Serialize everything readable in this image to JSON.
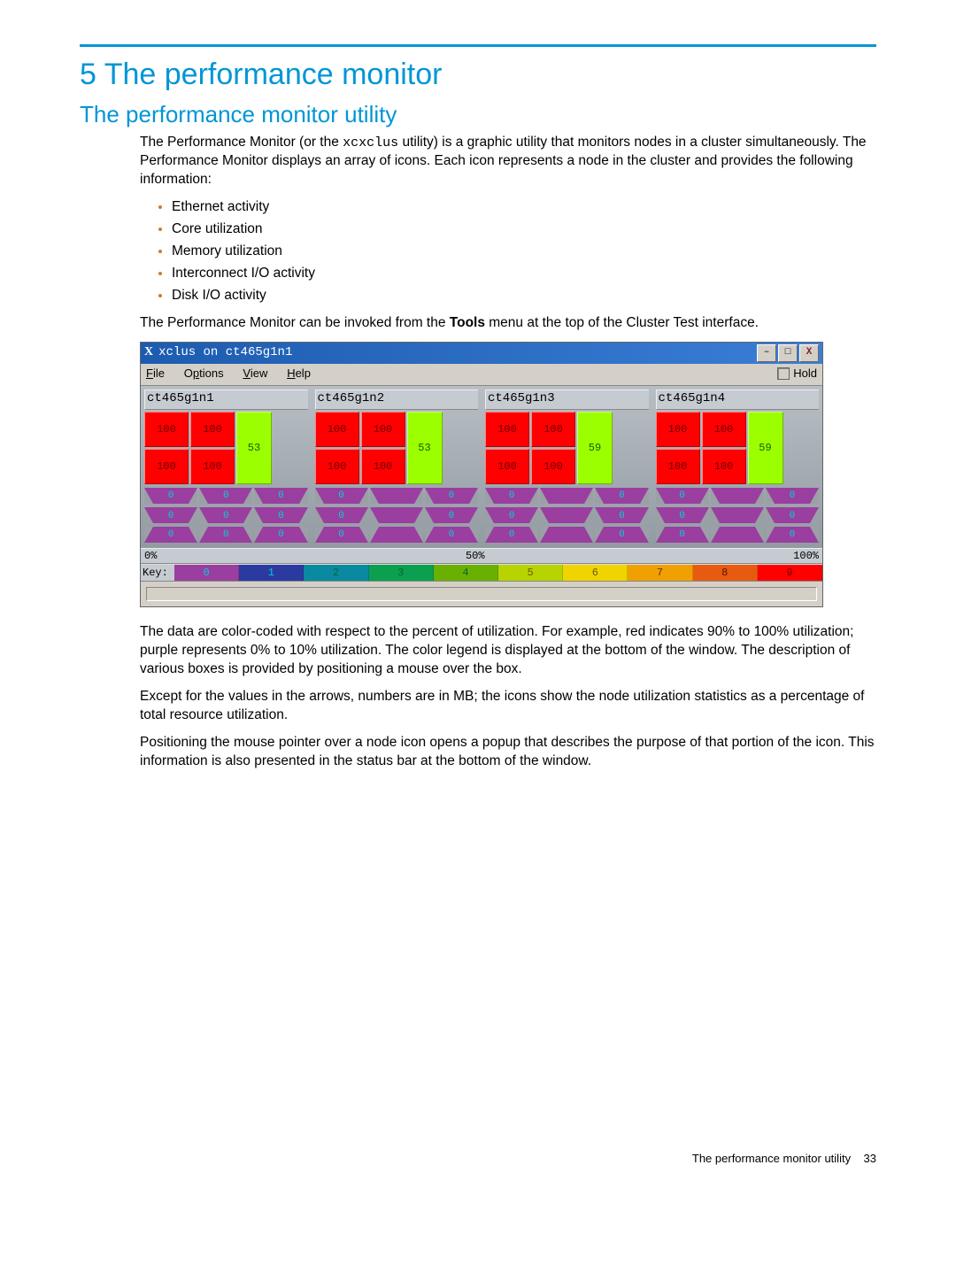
{
  "chapter_title": "5 The performance monitor",
  "section_title": "The performance monitor utility",
  "intro_prefix": "The Performance Monitor (or the ",
  "intro_code": "xcxclus",
  "intro_suffix": " utility) is a graphic utility that monitors nodes in a cluster simultaneously. The Performance Monitor displays an array of icons. Each icon represents a node in the cluster and provides the following information:",
  "bullets": [
    "Ethernet activity",
    "Core utilization",
    "Memory utilization",
    "Interconnect I/O activity",
    "Disk I/O activity"
  ],
  "invoke_prefix": "The Performance Monitor can be invoked from the ",
  "invoke_bold": "Tools",
  "invoke_suffix": " menu at the top of the Cluster Test interface.",
  "window": {
    "title": "xclus on ct465g1n1",
    "menu": {
      "file": "File",
      "options": "Options",
      "view": "View",
      "help": "Help",
      "hold": "Hold"
    },
    "scale": {
      "left": "0%",
      "mid": "50%",
      "right": "100%"
    },
    "key_label": "Key:",
    "key_values": [
      "0",
      "1",
      "2",
      "3",
      "4",
      "5",
      "6",
      "7",
      "8",
      "9"
    ],
    "nodes": [
      {
        "name": "ct465g1n1",
        "cores": [
          "100",
          "100",
          "100",
          "100"
        ],
        "side": "53",
        "arrows_top": [
          "0",
          "0",
          "0"
        ],
        "arrows_mid": [
          "0",
          "0",
          "0"
        ],
        "arrows_bot": [
          "0",
          "0",
          "0"
        ]
      },
      {
        "name": "ct465g1n2",
        "cores": [
          "100",
          "100",
          "100",
          "100"
        ],
        "side": "53",
        "arrows_top": [
          "0",
          "",
          "0"
        ],
        "arrows_mid": [
          "0",
          "",
          "0"
        ],
        "arrows_bot": [
          "0",
          "",
          "0"
        ]
      },
      {
        "name": "ct465g1n3",
        "cores": [
          "100",
          "100",
          "100",
          "100"
        ],
        "side": "59",
        "arrows_top": [
          "0",
          "",
          "0"
        ],
        "arrows_mid": [
          "0",
          "",
          "0"
        ],
        "arrows_bot": [
          "0",
          "",
          "0"
        ]
      },
      {
        "name": "ct465g1n4",
        "cores": [
          "100",
          "100",
          "100",
          "100"
        ],
        "side": "59",
        "arrows_top": [
          "0",
          "",
          "0"
        ],
        "arrows_mid": [
          "0",
          "",
          "0"
        ],
        "arrows_bot": [
          "0",
          "",
          "0"
        ]
      }
    ]
  },
  "para2": "The data are color-coded with respect to the percent of utilization. For example, red indicates 90% to 100% utilization; purple represents 0% to 10% utilization. The color legend is displayed at the bottom of the window. The description of various boxes is provided by positioning a mouse over the box.",
  "para3": "Except for the values in the arrows, numbers are in MB; the icons show the node utilization statistics as a percentage of total resource utilization.",
  "para4": "Positioning the mouse pointer over a node icon opens a popup that describes the purpose of that portion of the icon. This information is also presented in the status bar at the bottom of the window.",
  "footer_label": "The performance monitor utility",
  "footer_page": "33"
}
